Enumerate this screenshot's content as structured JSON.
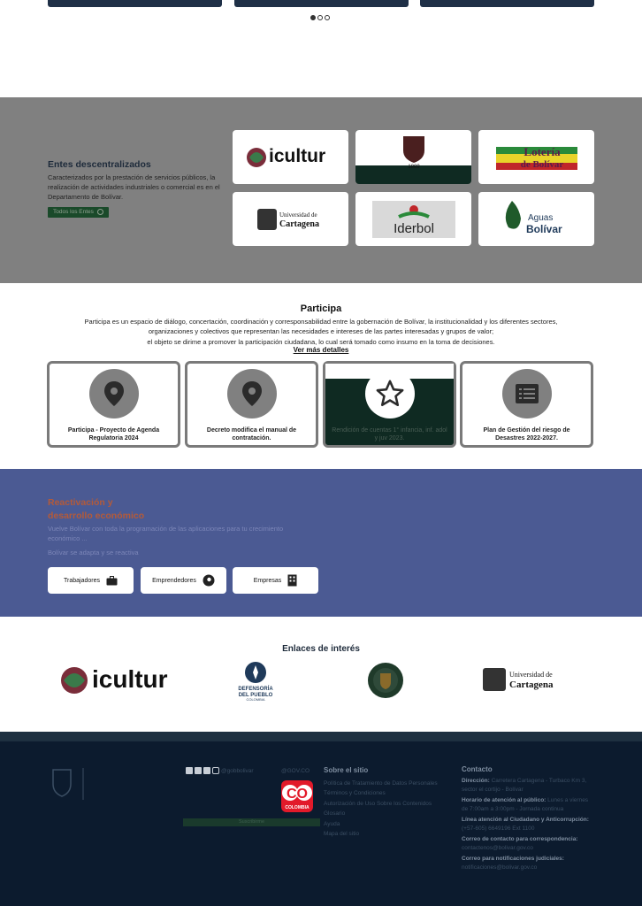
{
  "colors": {
    "gray_band": "#808080",
    "navy_band": "#4b5a93",
    "footer_bg": "#0c1b2e",
    "dark_green": "#0f2a22",
    "accent_orange": "#b35a3a"
  },
  "carousel": {
    "dots": [
      true,
      false,
      false
    ]
  },
  "entes": {
    "title": "Entes descentralizados",
    "description": "Caracterizados por la prestación de servicios públicos, la realización de actividades industriales o comercial es en el Departamento de Bolívar.",
    "button_label": "Todos los Entes",
    "logos": [
      {
        "name": "icultur",
        "alt_text": "icultur"
      },
      {
        "name": "escudo-1889",
        "alt_text": "1889"
      },
      {
        "name": "loteria-de-bolivar",
        "alt_text": "Lotería de Bolívar"
      },
      {
        "name": "universidad-de-cartagena",
        "alt_text": "Universidad de Cartagena"
      },
      {
        "name": "iderbol",
        "alt_text": "Iderbol"
      },
      {
        "name": "aguas-de-bolivar",
        "alt_text": "Aguas de Bolívar"
      }
    ]
  },
  "participa": {
    "title": "Participa",
    "description_lines": [
      "Participa es un espacio de diálogo, concertación, coordinación y corresponsabilidad entre la gobernación de Bolívar, la institucionalidad y los diferentes sectores,",
      "organizaciones y colectivos que representan las necesidades e intereses de las partes interesadas y grupos de valor;",
      "el objeto se dirime a promover la participación ciudadana, lo cual será tomado como insumo en la toma de decisiones."
    ],
    "link_label": "Ver más detalles",
    "cards": [
      {
        "label": "Participa - Proyecto de Agenda Regulatoria 2024",
        "icon": "map-pin-icon"
      },
      {
        "label": "Decreto modifica el manual de contratación.",
        "icon": "map-pin-icon"
      },
      {
        "label": "Rendición de cuentas 1° infancia, inf. adol y juv 2023.",
        "icon": "star-icon"
      },
      {
        "label": "Plan de Gestión del riesgo de Desastres 2022-2027.",
        "icon": "list-icon"
      }
    ]
  },
  "reactivacion": {
    "title_line1": "Reactivación y",
    "title_line2": "desarrollo económico",
    "description": "Vuelve Bolívar con toda la programación de las aplicaciones para tu crecimiento económico ...",
    "subtitle": "Bolívar se adapta y se reactiva",
    "buttons": [
      {
        "label": "Trabajadores",
        "icon": "briefcase-icon"
      },
      {
        "label": "Emprendedores",
        "icon": "idea-head-icon"
      },
      {
        "label": "Empresas",
        "icon": "building-icon"
      }
    ]
  },
  "enlaces": {
    "title": "Enlaces de interés",
    "logos": [
      {
        "name": "icultur",
        "alt_text": "icultur"
      },
      {
        "name": "defensoria-del-pueblo",
        "alt_text": "DEFENSORÍA DEL PUEBLO COLOMBIA"
      },
      {
        "name": "policia-escudo",
        "alt_text": ""
      },
      {
        "name": "universidad-de-cartagena",
        "alt_text": "Universidad de Cartagena"
      }
    ]
  },
  "footer": {
    "social_handle": "@gobbolivar",
    "govco_label": "@GOV.CO",
    "co_badge": "CO",
    "co_caption": "COLOMBIA",
    "subscribe_label": "Suscribirme",
    "sobre_title": "Sobre el sitio",
    "sobre_items": [
      "Política de Tratamiento de Datos Personales",
      "Términos y Condiciones",
      "Autorización de Uso Sobre los Contenidos",
      "Glosario",
      "Ayuda",
      "Mapa del sitio"
    ],
    "contacto_title": "Contacto",
    "direccion_label": "Dirección:",
    "direccion_value": "Carretera Cartagena - Turbaco Km 3, sector el cortijo - Bolívar",
    "horario_label": "Horario de atención al público:",
    "horario_value": "Lunes a viernes de 7:00am a 3:00pm - Jornada continua",
    "linea_label": "Línea atención al Ciudadano y Anticorrupción:",
    "linea_value": "(+57-605) 6649196 Ext 1100",
    "correo_label": "Correo de contacto para correspondencia:",
    "correo_value": "contactenos@bolivar.gov.co",
    "notif_label": "Correo para notificaciones judiciales:",
    "notif_value": "notificaciones@bolivar.gov.co"
  }
}
